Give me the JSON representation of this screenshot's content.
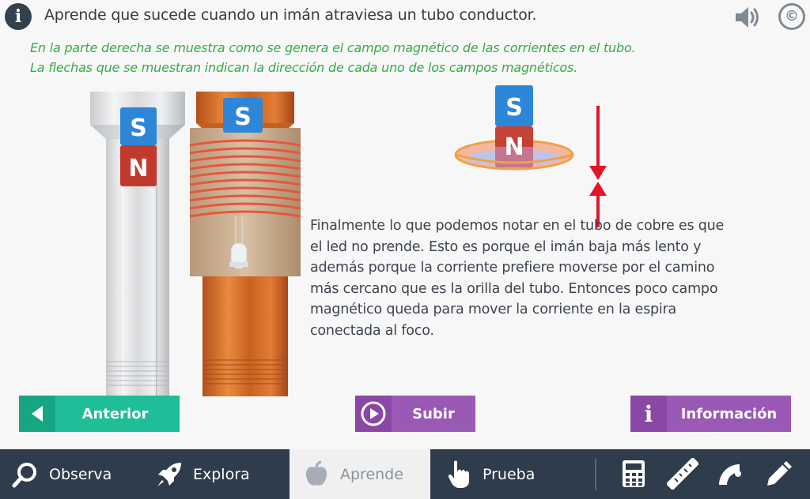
{
  "header": {
    "info_icon_glyph": "i",
    "title": "Aprende que sucede cuando un imán atraviesa un tubo conductor.",
    "copyright_glyph": "©"
  },
  "subtitle": {
    "line1": "En la parte derecha se muestra como se genera el campo magnético de las corrientes en el tubo.",
    "line2": "La flechas que se muestran indican la dirección de cada uno de los campos magnéticos."
  },
  "illustration": {
    "left_magnet_top": "S",
    "left_magnet_bottom": "N",
    "right_magnet_top": "S",
    "ring_magnet_top": "S",
    "ring_magnet_bottom": "N"
  },
  "body": {
    "lines": [
      "Finalmente lo que podemos notar en el tubo de cobre es que",
      "el led no prende. Esto es porque el imán baja más lento y",
      "además porque la corriente prefiere moverse por el camino",
      "más cercano que es la orilla del tubo. Entonces poco campo",
      "magnético queda para mover la corriente en la espira",
      "conectada al foco."
    ]
  },
  "buttons": {
    "previous": "Anterior",
    "up": "Subir",
    "info": "Información",
    "info_glyph": "i"
  },
  "nav": {
    "observe": "Observa",
    "explore": "Explora",
    "learn": "Aprende",
    "test": "Prueba"
  },
  "colors": {
    "green_text": "#3ba94c",
    "prev_button": "#1fbd98",
    "purple_button": "#9b59b6",
    "navbar": "#2f3c4b",
    "magnet_blue": "#2e86d8",
    "magnet_red": "#c23a2e",
    "field_arrow": "#e3142a"
  }
}
